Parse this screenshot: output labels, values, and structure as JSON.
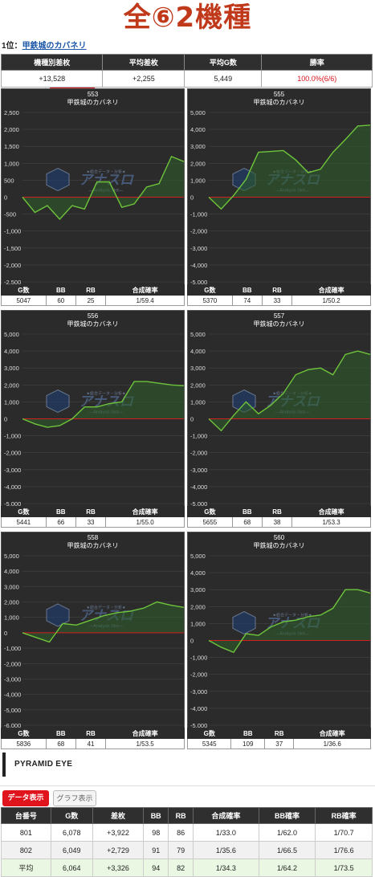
{
  "title": "全⑥2機種",
  "rank": {
    "label": "1位：",
    "machine_link": "甲鉄城のカバネリ"
  },
  "summary": {
    "headers": [
      "機種別差枚",
      "平均差枚",
      "平均G数",
      "勝率"
    ],
    "values": [
      "+13,528",
      "+2,255",
      "5,449",
      "100.0%(6/6)"
    ]
  },
  "stats_headers": [
    "G数",
    "BB",
    "RB",
    "合成確率"
  ],
  "machine_name": "甲鉄城のカバネリ",
  "watermark": {
    "logo_text": "アナスロ",
    "top_text": "★総合データ・分析★",
    "bottom_text": "—Analysis Slot—"
  },
  "colors": {
    "title": "#c0391b",
    "line": "#6ec43b",
    "fill": "#2e5e2a",
    "zero": "#d21f1f",
    "panel_bg": "#2b2b2b",
    "win": "#d6141c"
  },
  "panels": [
    {
      "number": "553",
      "stats": [
        "5047",
        "60",
        "25",
        "1/59.4"
      ],
      "chart_data": {
        "type": "area",
        "ylim": [
          -2500,
          2500
        ],
        "yticks": [
          2500,
          2000,
          1500,
          1000,
          500,
          0,
          -500,
          -1000,
          -1500,
          -2000,
          -2500
        ],
        "y": [
          0,
          -450,
          -250,
          -650,
          -250,
          -350,
          450,
          450,
          -300,
          -200,
          300,
          400,
          1200,
          1050
        ]
      }
    },
    {
      "number": "555",
      "stats": [
        "5370",
        "74",
        "33",
        "1/50.2"
      ],
      "chart_data": {
        "type": "area",
        "ylim": [
          -5000,
          5000
        ],
        "yticks": [
          5000,
          4000,
          3000,
          2000,
          1000,
          0,
          -1000,
          -2000,
          -3000,
          -4000,
          -5000
        ],
        "y": [
          0,
          -700,
          100,
          1050,
          2650,
          2700,
          2750,
          2200,
          1450,
          1650,
          2650,
          3400,
          4200,
          4250
        ]
      }
    },
    {
      "number": "556",
      "stats": [
        "5441",
        "66",
        "33",
        "1/55.0"
      ],
      "chart_data": {
        "type": "area",
        "ylim": [
          -5000,
          5000
        ],
        "yticks": [
          5000,
          4000,
          3000,
          2000,
          1000,
          0,
          -1000,
          -2000,
          -3000,
          -4000,
          -5000
        ],
        "y": [
          0,
          -300,
          -500,
          -400,
          0,
          700,
          700,
          900,
          1000,
          2200,
          2200,
          2100,
          2000,
          1950
        ]
      }
    },
    {
      "number": "557",
      "stats": [
        "5655",
        "68",
        "38",
        "1/53.3"
      ],
      "chart_data": {
        "type": "area",
        "ylim": [
          -5000,
          5000
        ],
        "yticks": [
          5000,
          4000,
          3000,
          2000,
          1000,
          0,
          -1000,
          -2000,
          -3000,
          -4000,
          -5000
        ],
        "y": [
          0,
          -700,
          200,
          1000,
          300,
          800,
          1500,
          2600,
          2900,
          3000,
          2600,
          3800,
          4000,
          3800
        ]
      }
    },
    {
      "number": "558",
      "stats": [
        "5836",
        "68",
        "41",
        "1/53.5"
      ],
      "chart_data": {
        "type": "area",
        "ylim": [
          -6000,
          5000
        ],
        "yticks": [
          5000,
          4000,
          3000,
          2000,
          1000,
          0,
          -1000,
          -2000,
          -3000,
          -4000,
          -5000,
          -6000
        ],
        "y": [
          0,
          -300,
          -600,
          600,
          500,
          800,
          1100,
          1300,
          1400,
          1600,
          2000,
          1800,
          1650
        ]
      }
    },
    {
      "number": "560",
      "stats": [
        "5345",
        "109",
        "37",
        "1/36.6"
      ],
      "chart_data": {
        "type": "area",
        "ylim": [
          -5000,
          5000
        ],
        "yticks": [
          5000,
          4000,
          3000,
          2000,
          1000,
          0,
          -1000,
          -2000,
          -3000,
          -4000,
          -5000
        ],
        "y": [
          0,
          -400,
          -700,
          400,
          300,
          800,
          1100,
          1200,
          1400,
          1500,
          1900,
          3000,
          3000,
          2800
        ]
      }
    }
  ],
  "pyramid": {
    "title": "PYRAMID EYE",
    "tabs": {
      "data": "データ表示",
      "graph": "グラフ表示"
    },
    "headers": [
      "台番号",
      "G数",
      "差枚",
      "BB",
      "RB",
      "合成確率",
      "BB確率",
      "RB確率"
    ],
    "rows": [
      [
        "801",
        "6,078",
        "+3,922",
        "98",
        "86",
        "1/33.0",
        "1/62.0",
        "1/70.7"
      ],
      [
        "802",
        "6,049",
        "+2,729",
        "91",
        "79",
        "1/35.6",
        "1/66.5",
        "1/76.6"
      ],
      [
        "平均",
        "6,064",
        "+3,326",
        "94",
        "82",
        "1/34.3",
        "1/64.2",
        "1/73.5"
      ]
    ]
  }
}
